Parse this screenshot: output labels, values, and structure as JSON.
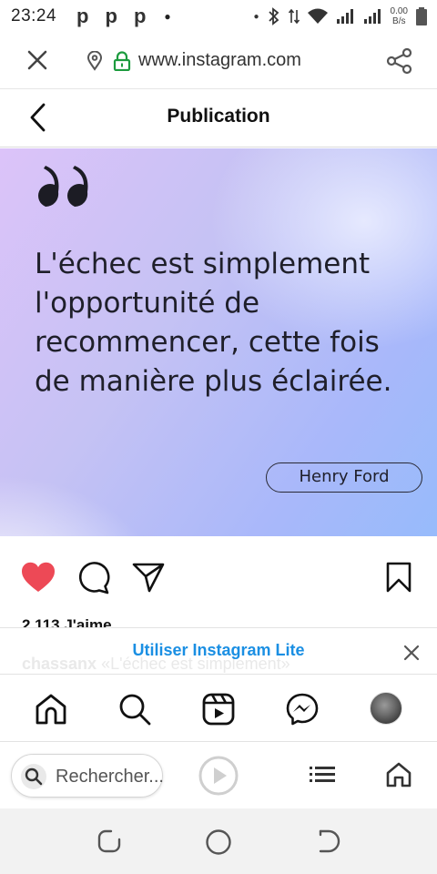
{
  "status_bar": {
    "time": "23:24",
    "app_icons": [
      "p",
      "p",
      "p"
    ],
    "speed_value": "0.00",
    "speed_unit": "B/s"
  },
  "browser": {
    "url": "www.instagram.com"
  },
  "header": {
    "title": "Publication"
  },
  "post": {
    "quote": "L'échec est simplement l'opportunité de recommencer, cette fois de manière plus éclairée.",
    "author": "Henry Ford",
    "likes": "2 113 J'aime",
    "caption_user": "chassanx",
    "caption_text": "«L'échec est simplement»"
  },
  "lite_banner": {
    "cta": "Utiliser Instagram Lite"
  },
  "browser_bottom": {
    "search_placeholder": "Rechercher..."
  },
  "colors": {
    "like_red": "#ed4956",
    "link_blue": "#1a8fe3"
  }
}
